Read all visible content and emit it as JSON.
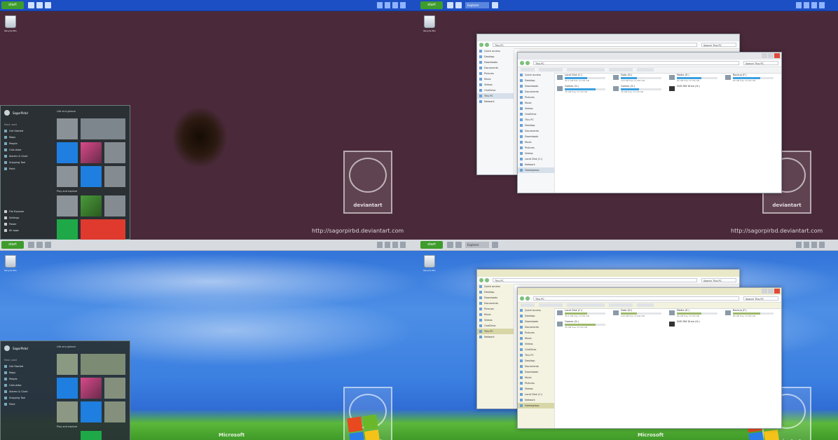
{
  "taskbar": {
    "start_label": "start",
    "tasks": [
      "Explorer",
      "Explorer"
    ]
  },
  "desktop": {
    "recycle_bin_label": "Recycle Bin",
    "watermark_text": "deviantart",
    "url_text": "http://sagorpirbd.deviantart.com",
    "microsoft_text": "Microsoft"
  },
  "start_menu": {
    "user_name": "SagorPirbd",
    "most_used_header": "Most used",
    "items": [
      "Get Started",
      "Maps",
      "People",
      "Calculator",
      "Alarms & Clock",
      "Snipping Tool",
      "Paint"
    ],
    "bottom_items": [
      "File Explorer",
      "Settings",
      "Power",
      "All apps"
    ],
    "life_header": "Life at a glance",
    "play_header": "Play and explore"
  },
  "explorer": {
    "address": "This PC",
    "search_placeholder": "Search This PC",
    "nav_items": [
      "Quick access",
      "Desktop",
      "Downloads",
      "Documents",
      "Pictures",
      "Music",
      "Videos",
      "OneDrive",
      "This PC",
      "Desktop",
      "Documents",
      "Downloads",
      "Music",
      "Pictures",
      "Videos",
      "Local Disk (C:)",
      "Network",
      "Homegroup"
    ],
    "selected_nav": "This PC",
    "drives": [
      {
        "name": "Local Disk (C:)",
        "size": "45.2 GB free of 100 GB",
        "used": 0.55
      },
      {
        "name": "Data (D:)",
        "size": "120 GB free of 200 GB",
        "used": 0.4
      },
      {
        "name": "Media (E:)",
        "size": "60 GB free of 150 GB",
        "used": 0.6
      },
      {
        "name": "Backup (F:)",
        "size": "80 GB free of 250 GB",
        "used": 0.68
      },
      {
        "name": "Games (G:)",
        "size": "30 GB free of 120 GB",
        "used": 0.75
      },
      {
        "name": "DVD RW Drive (H:)",
        "size": "",
        "used": 0
      }
    ]
  },
  "colors": {
    "taskbar_blue": "#1d4fc4",
    "start_green": "#3e9c2c",
    "accent_blue": "#1e7fe0",
    "accent_red": "#e03a2f",
    "olive_theme": "#e9e8c8"
  }
}
